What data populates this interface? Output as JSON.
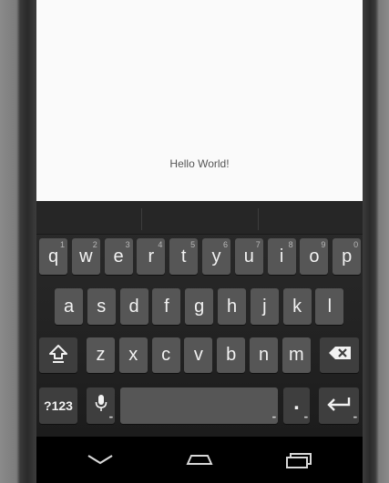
{
  "app": {
    "message": "Hello World!"
  },
  "keyboard": {
    "row1": [
      {
        "key": "q",
        "hint": "1"
      },
      {
        "key": "w",
        "hint": "2"
      },
      {
        "key": "e",
        "hint": "3"
      },
      {
        "key": "r",
        "hint": "4"
      },
      {
        "key": "t",
        "hint": "5"
      },
      {
        "key": "y",
        "hint": "6"
      },
      {
        "key": "u",
        "hint": "7"
      },
      {
        "key": "i",
        "hint": "8"
      },
      {
        "key": "o",
        "hint": "9"
      },
      {
        "key": "p",
        "hint": "0"
      }
    ],
    "row2": [
      "a",
      "s",
      "d",
      "f",
      "g",
      "h",
      "j",
      "k",
      "l"
    ],
    "row3": [
      "z",
      "x",
      "c",
      "v",
      "b",
      "n",
      "m"
    ],
    "symbols_label": "?123",
    "period_label": ".",
    "icons": {
      "shift": "shift-icon",
      "backspace": "backspace-icon",
      "mic": "microphone-icon",
      "enter": "enter-icon"
    }
  },
  "navbar": {
    "icons": [
      "back-icon",
      "home-icon",
      "recent-apps-icon"
    ]
  }
}
